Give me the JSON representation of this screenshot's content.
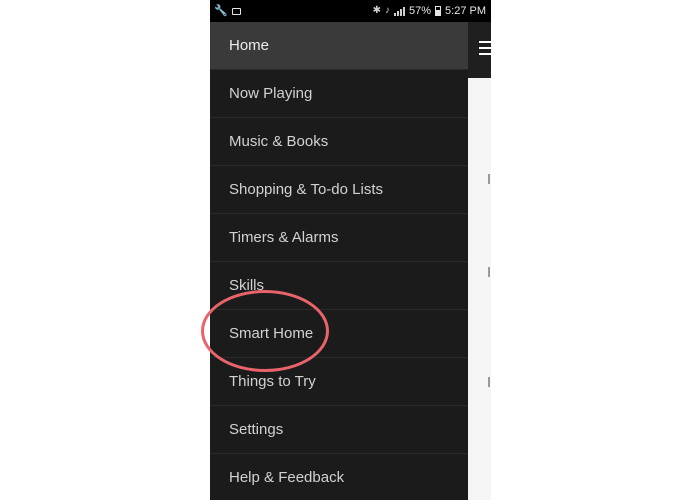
{
  "status_bar": {
    "battery": "57%",
    "time": "5:27 PM"
  },
  "icons": {
    "wrench": "wrench-icon",
    "sim": "sim-card-icon",
    "bluetooth": "bluetooth-icon",
    "mute": "mute-icon",
    "signal": "signal-icon",
    "battery": "battery-icon",
    "menu": "hamburger-menu-icon"
  },
  "colors": {
    "drawer_background": "#1b1b1b",
    "active_item_background": "#3a3a3a",
    "highlight_circle": "#e8646a"
  },
  "drawer": {
    "items": [
      {
        "label": "Home"
      },
      {
        "label": "Now Playing"
      },
      {
        "label": "Music & Books"
      },
      {
        "label": "Shopping & To-do Lists"
      },
      {
        "label": "Timers & Alarms"
      },
      {
        "label": "Skills"
      },
      {
        "label": "Smart Home"
      },
      {
        "label": "Things to Try"
      },
      {
        "label": "Settings"
      },
      {
        "label": "Help & Feedback"
      }
    ]
  }
}
